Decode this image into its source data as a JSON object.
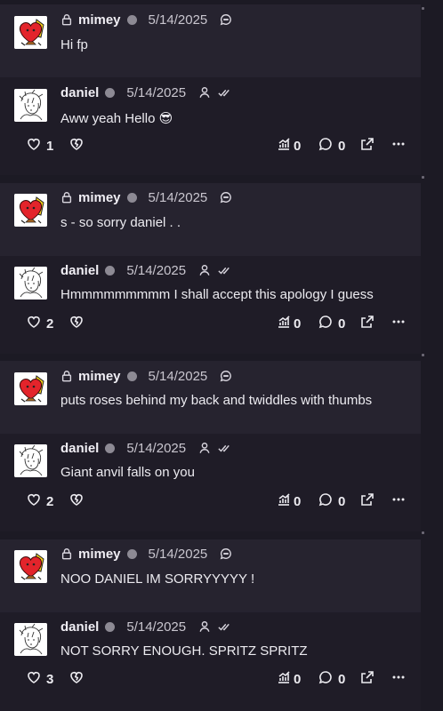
{
  "posts": [
    {
      "kind": "mimey",
      "user": "mimey",
      "date": "5/14/2025",
      "text": "Hi fp"
    },
    {
      "kind": "daniel",
      "user": "daniel",
      "date": "5/14/2025",
      "text": "Aww yeah Hello 😎",
      "likes": "1",
      "views": "0",
      "replies": "0"
    },
    {
      "kind": "mimey",
      "user": "mimey",
      "date": "5/14/2025",
      "text": "s - so sorry daniel . ."
    },
    {
      "kind": "daniel",
      "user": "daniel",
      "date": "5/14/2025",
      "text": "Hmmmmmmmmm I shall accept this apology I guess",
      "likes": "2",
      "views": "0",
      "replies": "0"
    },
    {
      "kind": "mimey",
      "user": "mimey",
      "date": "5/14/2025",
      "text": "puts roses behind my back and twiddles with thumbs"
    },
    {
      "kind": "daniel",
      "user": "daniel",
      "date": "5/14/2025",
      "text": "Giant anvil falls on you",
      "likes": "2",
      "views": "0",
      "replies": "0"
    },
    {
      "kind": "mimey",
      "user": "mimey",
      "date": "5/14/2025",
      "text": "NOO DANIEL IM SORRYYYYY !"
    },
    {
      "kind": "daniel",
      "user": "daniel",
      "date": "5/14/2025",
      "text": "NOT SORRY ENOUGH. SPRITZ SPRITZ",
      "likes": "3",
      "views": "0",
      "replies": "0"
    }
  ],
  "icons": {
    "lock": "lock-icon",
    "reply_bubble": "chat-bubble-icon",
    "person": "person-icon",
    "double_check": "double-check-icon",
    "heart": "heart-icon",
    "heart_broken": "broken-heart-icon",
    "stats": "stats-icon",
    "comment": "comment-icon",
    "share": "share-icon",
    "more": "more-icon"
  },
  "colors": {
    "background": "#1c1a24",
    "mimey_card": "#26232f",
    "daniel_card": "#1f1c27",
    "status_dot": "#8d8a94"
  }
}
